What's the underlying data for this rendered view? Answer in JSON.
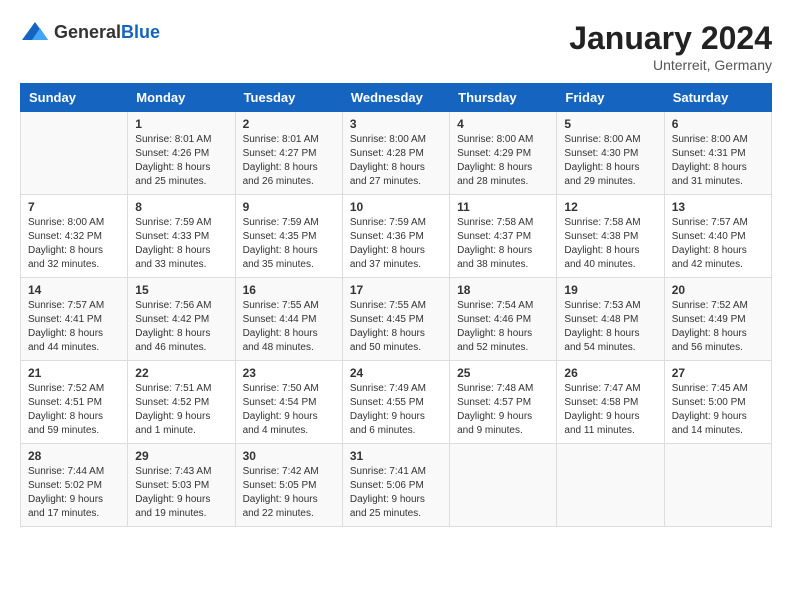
{
  "header": {
    "logo": {
      "general": "General",
      "blue": "Blue"
    },
    "month": "January 2024",
    "location": "Unterreit, Germany"
  },
  "days_of_week": [
    "Sunday",
    "Monday",
    "Tuesday",
    "Wednesday",
    "Thursday",
    "Friday",
    "Saturday"
  ],
  "weeks": [
    [
      {
        "day": "",
        "info": ""
      },
      {
        "day": "1",
        "info": "Sunrise: 8:01 AM\nSunset: 4:26 PM\nDaylight: 8 hours\nand 25 minutes."
      },
      {
        "day": "2",
        "info": "Sunrise: 8:01 AM\nSunset: 4:27 PM\nDaylight: 8 hours\nand 26 minutes."
      },
      {
        "day": "3",
        "info": "Sunrise: 8:00 AM\nSunset: 4:28 PM\nDaylight: 8 hours\nand 27 minutes."
      },
      {
        "day": "4",
        "info": "Sunrise: 8:00 AM\nSunset: 4:29 PM\nDaylight: 8 hours\nand 28 minutes."
      },
      {
        "day": "5",
        "info": "Sunrise: 8:00 AM\nSunset: 4:30 PM\nDaylight: 8 hours\nand 29 minutes."
      },
      {
        "day": "6",
        "info": "Sunrise: 8:00 AM\nSunset: 4:31 PM\nDaylight: 8 hours\nand 31 minutes."
      }
    ],
    [
      {
        "day": "7",
        "info": "Sunrise: 8:00 AM\nSunset: 4:32 PM\nDaylight: 8 hours\nand 32 minutes."
      },
      {
        "day": "8",
        "info": "Sunrise: 7:59 AM\nSunset: 4:33 PM\nDaylight: 8 hours\nand 33 minutes."
      },
      {
        "day": "9",
        "info": "Sunrise: 7:59 AM\nSunset: 4:35 PM\nDaylight: 8 hours\nand 35 minutes."
      },
      {
        "day": "10",
        "info": "Sunrise: 7:59 AM\nSunset: 4:36 PM\nDaylight: 8 hours\nand 37 minutes."
      },
      {
        "day": "11",
        "info": "Sunrise: 7:58 AM\nSunset: 4:37 PM\nDaylight: 8 hours\nand 38 minutes."
      },
      {
        "day": "12",
        "info": "Sunrise: 7:58 AM\nSunset: 4:38 PM\nDaylight: 8 hours\nand 40 minutes."
      },
      {
        "day": "13",
        "info": "Sunrise: 7:57 AM\nSunset: 4:40 PM\nDaylight: 8 hours\nand 42 minutes."
      }
    ],
    [
      {
        "day": "14",
        "info": "Sunrise: 7:57 AM\nSunset: 4:41 PM\nDaylight: 8 hours\nand 44 minutes."
      },
      {
        "day": "15",
        "info": "Sunrise: 7:56 AM\nSunset: 4:42 PM\nDaylight: 8 hours\nand 46 minutes."
      },
      {
        "day": "16",
        "info": "Sunrise: 7:55 AM\nSunset: 4:44 PM\nDaylight: 8 hours\nand 48 minutes."
      },
      {
        "day": "17",
        "info": "Sunrise: 7:55 AM\nSunset: 4:45 PM\nDaylight: 8 hours\nand 50 minutes."
      },
      {
        "day": "18",
        "info": "Sunrise: 7:54 AM\nSunset: 4:46 PM\nDaylight: 8 hours\nand 52 minutes."
      },
      {
        "day": "19",
        "info": "Sunrise: 7:53 AM\nSunset: 4:48 PM\nDaylight: 8 hours\nand 54 minutes."
      },
      {
        "day": "20",
        "info": "Sunrise: 7:52 AM\nSunset: 4:49 PM\nDaylight: 8 hours\nand 56 minutes."
      }
    ],
    [
      {
        "day": "21",
        "info": "Sunrise: 7:52 AM\nSunset: 4:51 PM\nDaylight: 8 hours\nand 59 minutes."
      },
      {
        "day": "22",
        "info": "Sunrise: 7:51 AM\nSunset: 4:52 PM\nDaylight: 9 hours\nand 1 minute."
      },
      {
        "day": "23",
        "info": "Sunrise: 7:50 AM\nSunset: 4:54 PM\nDaylight: 9 hours\nand 4 minutes."
      },
      {
        "day": "24",
        "info": "Sunrise: 7:49 AM\nSunset: 4:55 PM\nDaylight: 9 hours\nand 6 minutes."
      },
      {
        "day": "25",
        "info": "Sunrise: 7:48 AM\nSunset: 4:57 PM\nDaylight: 9 hours\nand 9 minutes."
      },
      {
        "day": "26",
        "info": "Sunrise: 7:47 AM\nSunset: 4:58 PM\nDaylight: 9 hours\nand 11 minutes."
      },
      {
        "day": "27",
        "info": "Sunrise: 7:45 AM\nSunset: 5:00 PM\nDaylight: 9 hours\nand 14 minutes."
      }
    ],
    [
      {
        "day": "28",
        "info": "Sunrise: 7:44 AM\nSunset: 5:02 PM\nDaylight: 9 hours\nand 17 minutes."
      },
      {
        "day": "29",
        "info": "Sunrise: 7:43 AM\nSunset: 5:03 PM\nDaylight: 9 hours\nand 19 minutes."
      },
      {
        "day": "30",
        "info": "Sunrise: 7:42 AM\nSunset: 5:05 PM\nDaylight: 9 hours\nand 22 minutes."
      },
      {
        "day": "31",
        "info": "Sunrise: 7:41 AM\nSunset: 5:06 PM\nDaylight: 9 hours\nand 25 minutes."
      },
      {
        "day": "",
        "info": ""
      },
      {
        "day": "",
        "info": ""
      },
      {
        "day": "",
        "info": ""
      }
    ]
  ]
}
